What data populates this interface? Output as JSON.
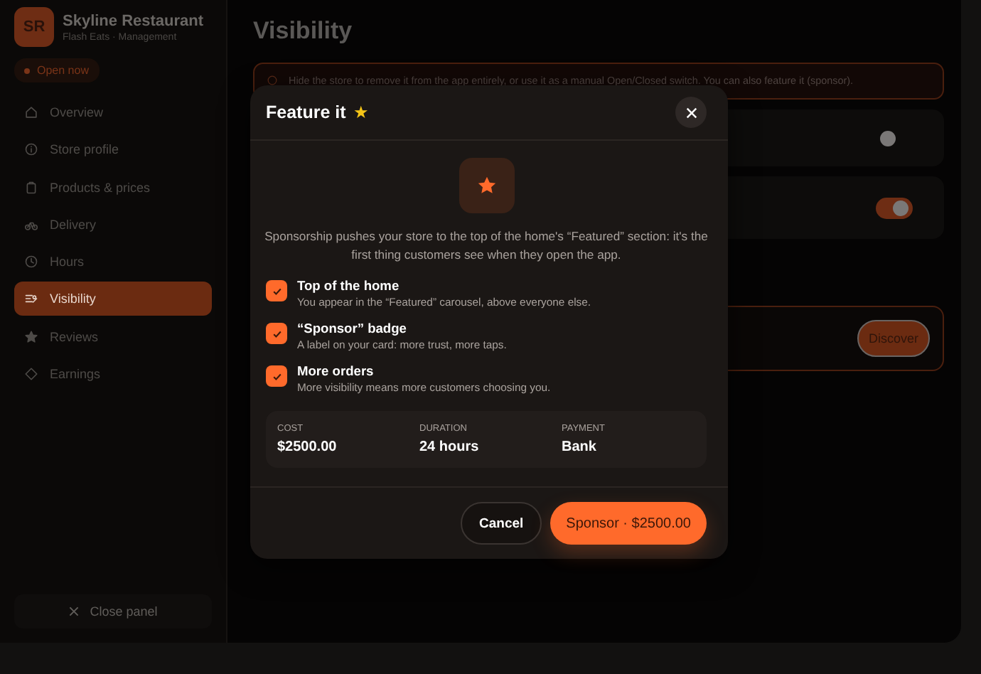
{
  "sidebar": {
    "avatar": "SR",
    "name": "Skyline Restaurant",
    "subtitle": "Flash Eats · Management",
    "status": {
      "label": "Open now",
      "on": true
    },
    "items": [
      {
        "label": "Overview",
        "selected": false
      },
      {
        "label": "Store profile",
        "selected": false
      },
      {
        "label": "Products & prices",
        "selected": false
      },
      {
        "label": "Delivery",
        "selected": false
      },
      {
        "label": "Hours",
        "selected": false
      },
      {
        "label": "Visibility",
        "selected": true
      },
      {
        "label": "Reviews",
        "selected": false
      },
      {
        "label": "Earnings",
        "selected": false
      }
    ],
    "close": "Close panel"
  },
  "main": {
    "title": "Visibility",
    "notice": "Hide the store to remove it from the app entirely, or use it as a manual Open/Closed switch. You can also feature it (sponsor).",
    "toggles": [
      {
        "on": false
      },
      {
        "on": true
      }
    ],
    "feature_card": {
      "button": "Discover"
    }
  },
  "modal": {
    "title": "Feature it",
    "title_mark": "★",
    "description": "Sponsorship pushes your store to the top of the home's “Featured” section: it's the first thing customers see when they open the app.",
    "benefits": [
      {
        "title": "Top of the home",
        "text": "You appear in the “Featured” carousel, above everyone else.",
        "checked": true
      },
      {
        "title": "“Sponsor” badge",
        "text": "A label on your card: more trust, more taps.",
        "checked": true
      },
      {
        "title": "More orders",
        "text": "More visibility means more customers choosing you.",
        "checked": true
      }
    ],
    "summary": [
      {
        "label": "COST",
        "value": "$2500.00"
      },
      {
        "label": "DURATION",
        "value": "24 hours"
      },
      {
        "label": "PAYMENT",
        "value": "Bank"
      }
    ],
    "cancel": "Cancel",
    "confirm": "Sponsor · $2500.00"
  }
}
